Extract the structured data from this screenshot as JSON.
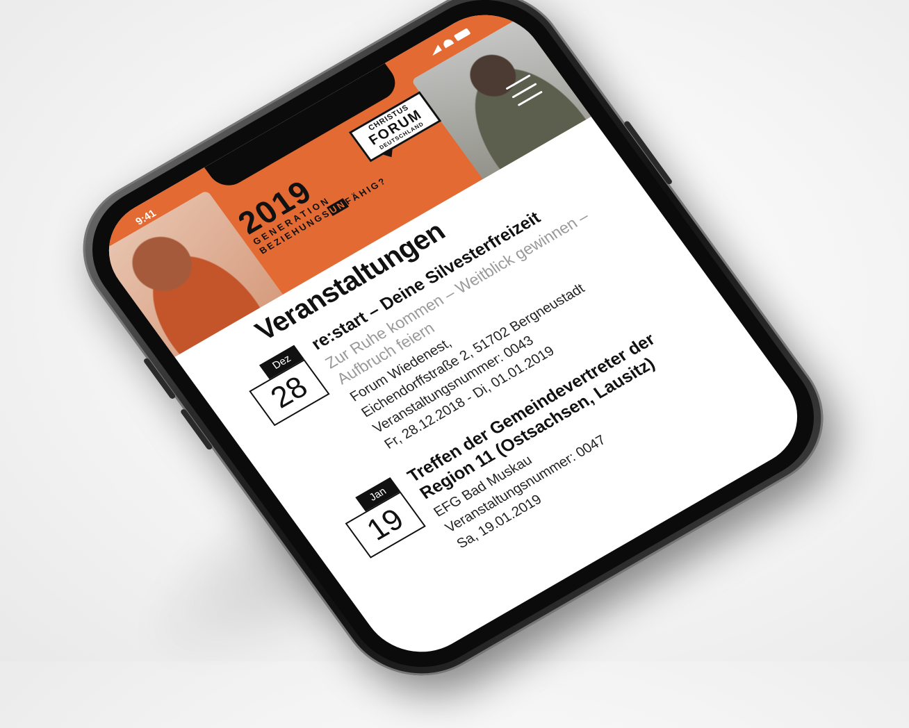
{
  "status_bar": {
    "time": "9:41"
  },
  "banner": {
    "year": "2019",
    "line1": "GENERATION",
    "line2_a": "BEZIEHUNGS",
    "line2_b": "UN",
    "line2_c": "FÄHIG?",
    "logo": {
      "line1": "CHRISTUS",
      "line2": "FORUM",
      "line3": "DEUTSCHLAND"
    },
    "accent_color": "#e36a33"
  },
  "page": {
    "title": "Veranstaltungen"
  },
  "events": [
    {
      "month": "Dez",
      "day": "28",
      "title": "re:start – Deine Silvesterfreizeit",
      "subtitle": "Zur Ruhe kommen – Weitblick gewinnen – Aufbruch feiern",
      "location": "Forum Wiedenest,",
      "address": "Eichendorffstraße 2, 51702 Bergneustadt",
      "number": "Veranstaltungsnummer: 0043",
      "dates": "Fr, 28.12.2018 - Di, 01.01.2019"
    },
    {
      "month": "Jan",
      "day": "19",
      "title": "Treffen der Gemeindevertreter der Region 11 (Ostsachsen, Lausitz)",
      "location": "EFG Bad Muskau",
      "number": "Veranstaltungsnummer: 0047",
      "dates": "Sa, 19.01.2019"
    }
  ]
}
